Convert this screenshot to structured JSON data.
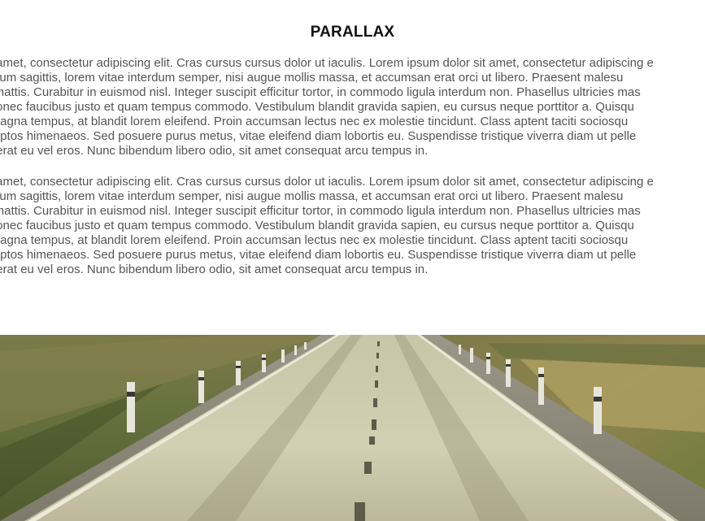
{
  "section": {
    "title": "PARALLAX"
  },
  "paragraphs": [
    {
      "lines": [
        "sit amet, consectetur adipiscing elit. Cras cursus cursus dolor ut iaculis. Lorem ipsum dolor sit amet, consectetur adipiscing e",
        "ibulum sagittis, lorem vitae interdum semper, nisi augue mollis massa, et accumsan erat orci ut libero. Praesent malesu",
        "at mattis. Curabitur in euismod nisl. Integer suscipit efficitur tortor, in commodo ligula interdum non. Phasellus ultricies mas",
        ". Donec faucibus justo et quam tempus commodo. Vestibulum blandit gravida sapien, eu cursus neque porttitor a. Quisqu",
        "s magna tempus, at blandit lorem eleifend. Proin accumsan lectus nec ex molestie tincidunt. Class aptent taciti sociosqu",
        "nceptos himenaeos. Sed posuere purus metus, vitae eleifend diam lobortis eu. Suspendisse tristique viverra diam ut pelle",
        "lacerat eu vel eros. Nunc bibendum libero odio, sit amet consequat arcu tempus in."
      ]
    },
    {
      "lines": [
        "sit amet, consectetur adipiscing elit. Cras cursus cursus dolor ut iaculis. Lorem ipsum dolor sit amet, consectetur adipiscing e",
        "ibulum sagittis, lorem vitae interdum semper, nisi augue mollis massa, et accumsan erat orci ut libero. Praesent malesu",
        "at mattis. Curabitur in euismod nisl. Integer suscipit efficitur tortor, in commodo ligula interdum non. Phasellus ultricies mas",
        ". Donec faucibus justo et quam tempus commodo. Vestibulum blandit gravida sapien, eu cursus neque porttitor a. Quisqu",
        "s magna tempus, at blandit lorem eleifend. Proin accumsan lectus nec ex molestie tincidunt. Class aptent taciti sociosqu",
        "nceptos himenaeos. Sed posuere purus metus, vitae eleifend diam lobortis eu. Suspendisse tristique viverra diam ut pelle",
        "lacerat eu vel eros. Nunc bibendum libero odio, sit amet consequat arcu tempus in."
      ]
    }
  ],
  "hero_image": {
    "subject": "road-through-fields",
    "colors": {
      "asphalt": "#cfcbb0",
      "grass": "#6b7a3f",
      "field": "#9a8e55",
      "gravel": "#8e8a7c"
    }
  }
}
